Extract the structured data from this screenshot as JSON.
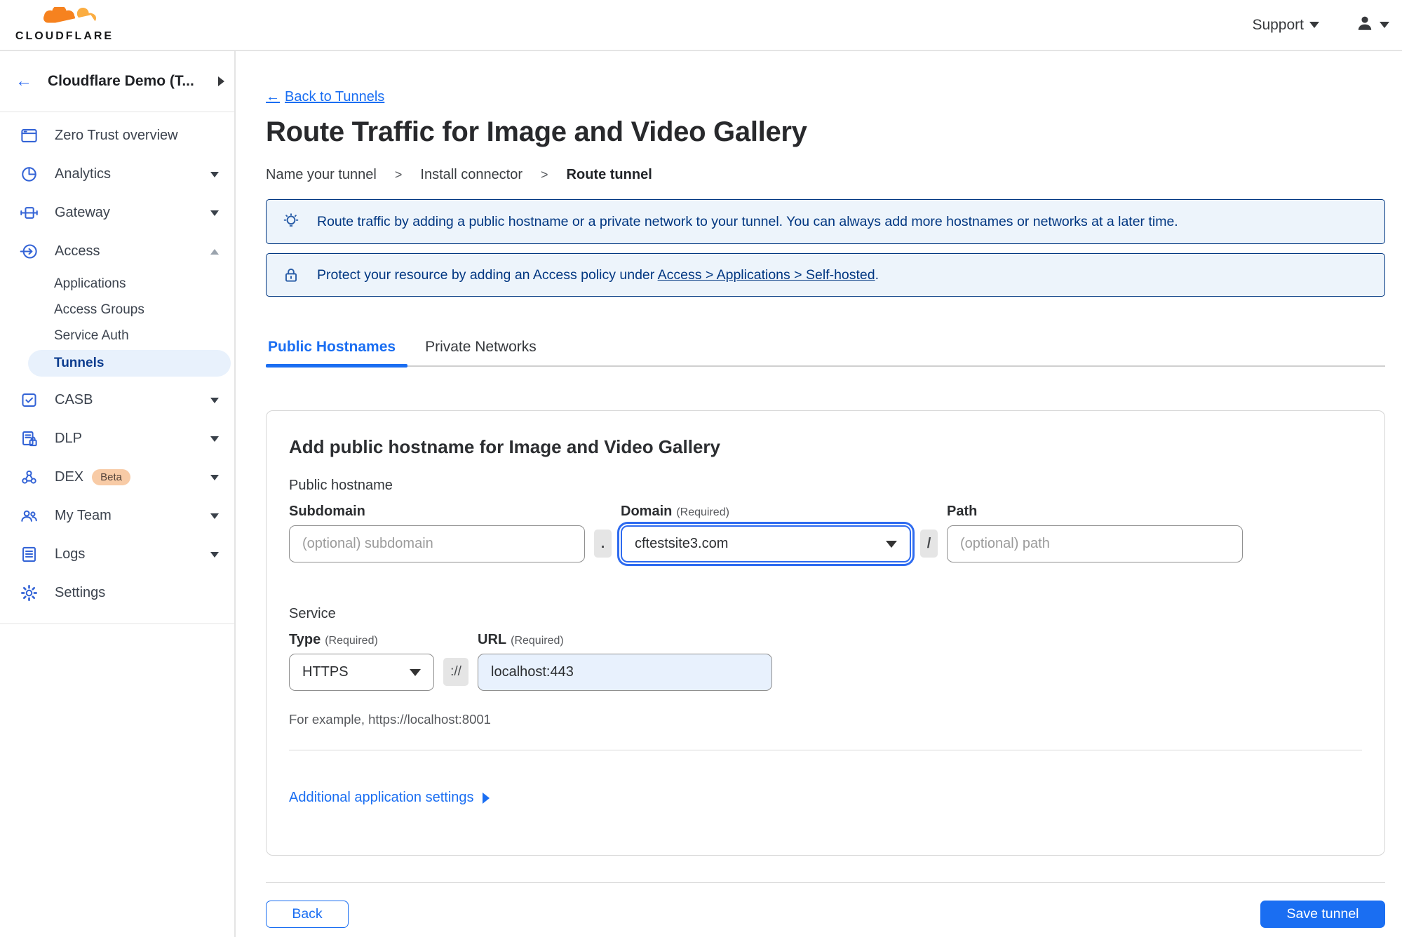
{
  "topbar": {
    "brand_word": "CLOUDFLARE",
    "support_label": "Support"
  },
  "sidebar": {
    "account_name": "Cloudflare Demo (T...",
    "items": [
      {
        "label": "Zero Trust overview",
        "icon": "browser-window-icon"
      },
      {
        "label": "Analytics",
        "icon": "pie-chart-icon"
      },
      {
        "label": "Gateway",
        "icon": "gateway-icon"
      },
      {
        "label": "Access",
        "icon": "access-arrow-icon"
      },
      {
        "label": "Applications"
      },
      {
        "label": "Access Groups"
      },
      {
        "label": "Service Auth"
      },
      {
        "label": "Tunnels"
      },
      {
        "label": "CASB",
        "icon": "checkbox-square-icon"
      },
      {
        "label": "DLP",
        "icon": "document-lock-icon"
      },
      {
        "label": "DEX",
        "icon": "network-nodes-icon",
        "badge": "Beta"
      },
      {
        "label": "My Team",
        "icon": "people-icon"
      },
      {
        "label": "Logs",
        "icon": "list-document-icon"
      },
      {
        "label": "Settings",
        "icon": "gear-icon"
      }
    ]
  },
  "page": {
    "back_arrow": "←",
    "back_link_label": "Back to Tunnels",
    "title": "Route Traffic for Image and Video Gallery",
    "breadcrumb": {
      "step1": "Name your tunnel",
      "sep": ">",
      "step2": "Install connector",
      "step3": "Route tunnel"
    },
    "banners": {
      "tip_text": "Route traffic by adding a public hostname or a private network to your tunnel. You can always add more hostnames or networks at a later time.",
      "protect_prefix": "Protect your resource by adding an Access policy under",
      "protect_link": "Access > Applications > Self-hosted",
      "protect_suffix": "."
    },
    "tabs": {
      "public_hostnames": "Public Hostnames",
      "private_networks": "Private Networks"
    },
    "form": {
      "heading": "Add public hostname for Image and Video Gallery",
      "public_hostname_label": "Public hostname",
      "subdomain_label": "Subdomain",
      "subdomain_placeholder": "(optional) subdomain",
      "dot_separator": ".",
      "domain_label": "Domain",
      "required_note": "(Required)",
      "domain_value": "cftestsite3.com",
      "slash_separator": "/",
      "path_label": "Path",
      "path_placeholder": "(optional) path",
      "service_label": "Service",
      "type_label": "Type",
      "type_value": "HTTPS",
      "scheme_separator": "://",
      "url_label": "URL",
      "url_value": "localhost:443",
      "example_text": "For example, https://localhost:8001",
      "additional_settings_label": "Additional application settings"
    },
    "footer": {
      "back_label": "Back",
      "save_label": "Save tunnel"
    }
  },
  "colors": {
    "accent_blue": "#1a6ef2",
    "banner_navy": "#003681",
    "banner_bg": "#edf4fb",
    "sidebar_icon_blue": "#3363d6",
    "active_pill_bg": "#e8f1fc",
    "beta_badge_bg": "#f8cba6",
    "cloud_orange": "#f6821f",
    "cloud_light_orange": "#fbad41"
  }
}
